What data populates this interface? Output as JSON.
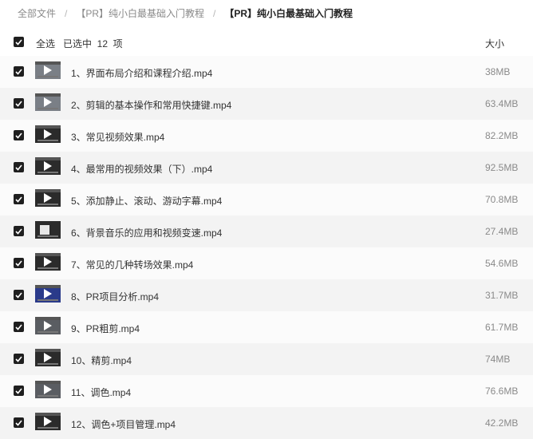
{
  "breadcrumb": {
    "items": [
      "全部文件",
      "【PR】纯小白最基础入门教程",
      "【PR】纯小白最基础入门教程"
    ],
    "separator": "/"
  },
  "list_header": {
    "select_all_label": "全选",
    "selected_count_label": "已选中  12  项",
    "size_column_label": "大小"
  },
  "files": [
    {
      "name": "1、界面布局介绍和课程介绍.mp4",
      "size": "38MB",
      "checked": true
    },
    {
      "name": "2、剪辑的基本操作和常用快捷键.mp4",
      "size": "63.4MB",
      "checked": true
    },
    {
      "name": "3、常见视频效果.mp4",
      "size": "82.2MB",
      "checked": true
    },
    {
      "name": "4、最常用的视频效果（下）.mp4",
      "size": "92.5MB",
      "checked": true
    },
    {
      "name": "5、添加静止、滚动、游动字幕.mp4",
      "size": "70.8MB",
      "checked": true
    },
    {
      "name": "6、背景音乐的应用和视频变速.mp4",
      "size": "27.4MB",
      "checked": true
    },
    {
      "name": "7、常见的几种转场效果.mp4",
      "size": "54.6MB",
      "checked": true
    },
    {
      "name": "8、PR项目分析.mp4",
      "size": "31.7MB",
      "checked": true
    },
    {
      "name": "9、PR粗剪.mp4",
      "size": "61.7MB",
      "checked": true
    },
    {
      "name": "10、精剪.mp4",
      "size": "74MB",
      "checked": true
    },
    {
      "name": "11、调色.mp4",
      "size": "76.6MB",
      "checked": true
    },
    {
      "name": "12、调色+项目管理.mp4",
      "size": "42.2MB",
      "checked": true
    }
  ],
  "colors": {
    "checkbox_fill": "#1f1f1f",
    "row_bg": "#fbfbfb",
    "row_bg_alt": "#f3f3f3",
    "size_text": "#8a8a8a"
  }
}
